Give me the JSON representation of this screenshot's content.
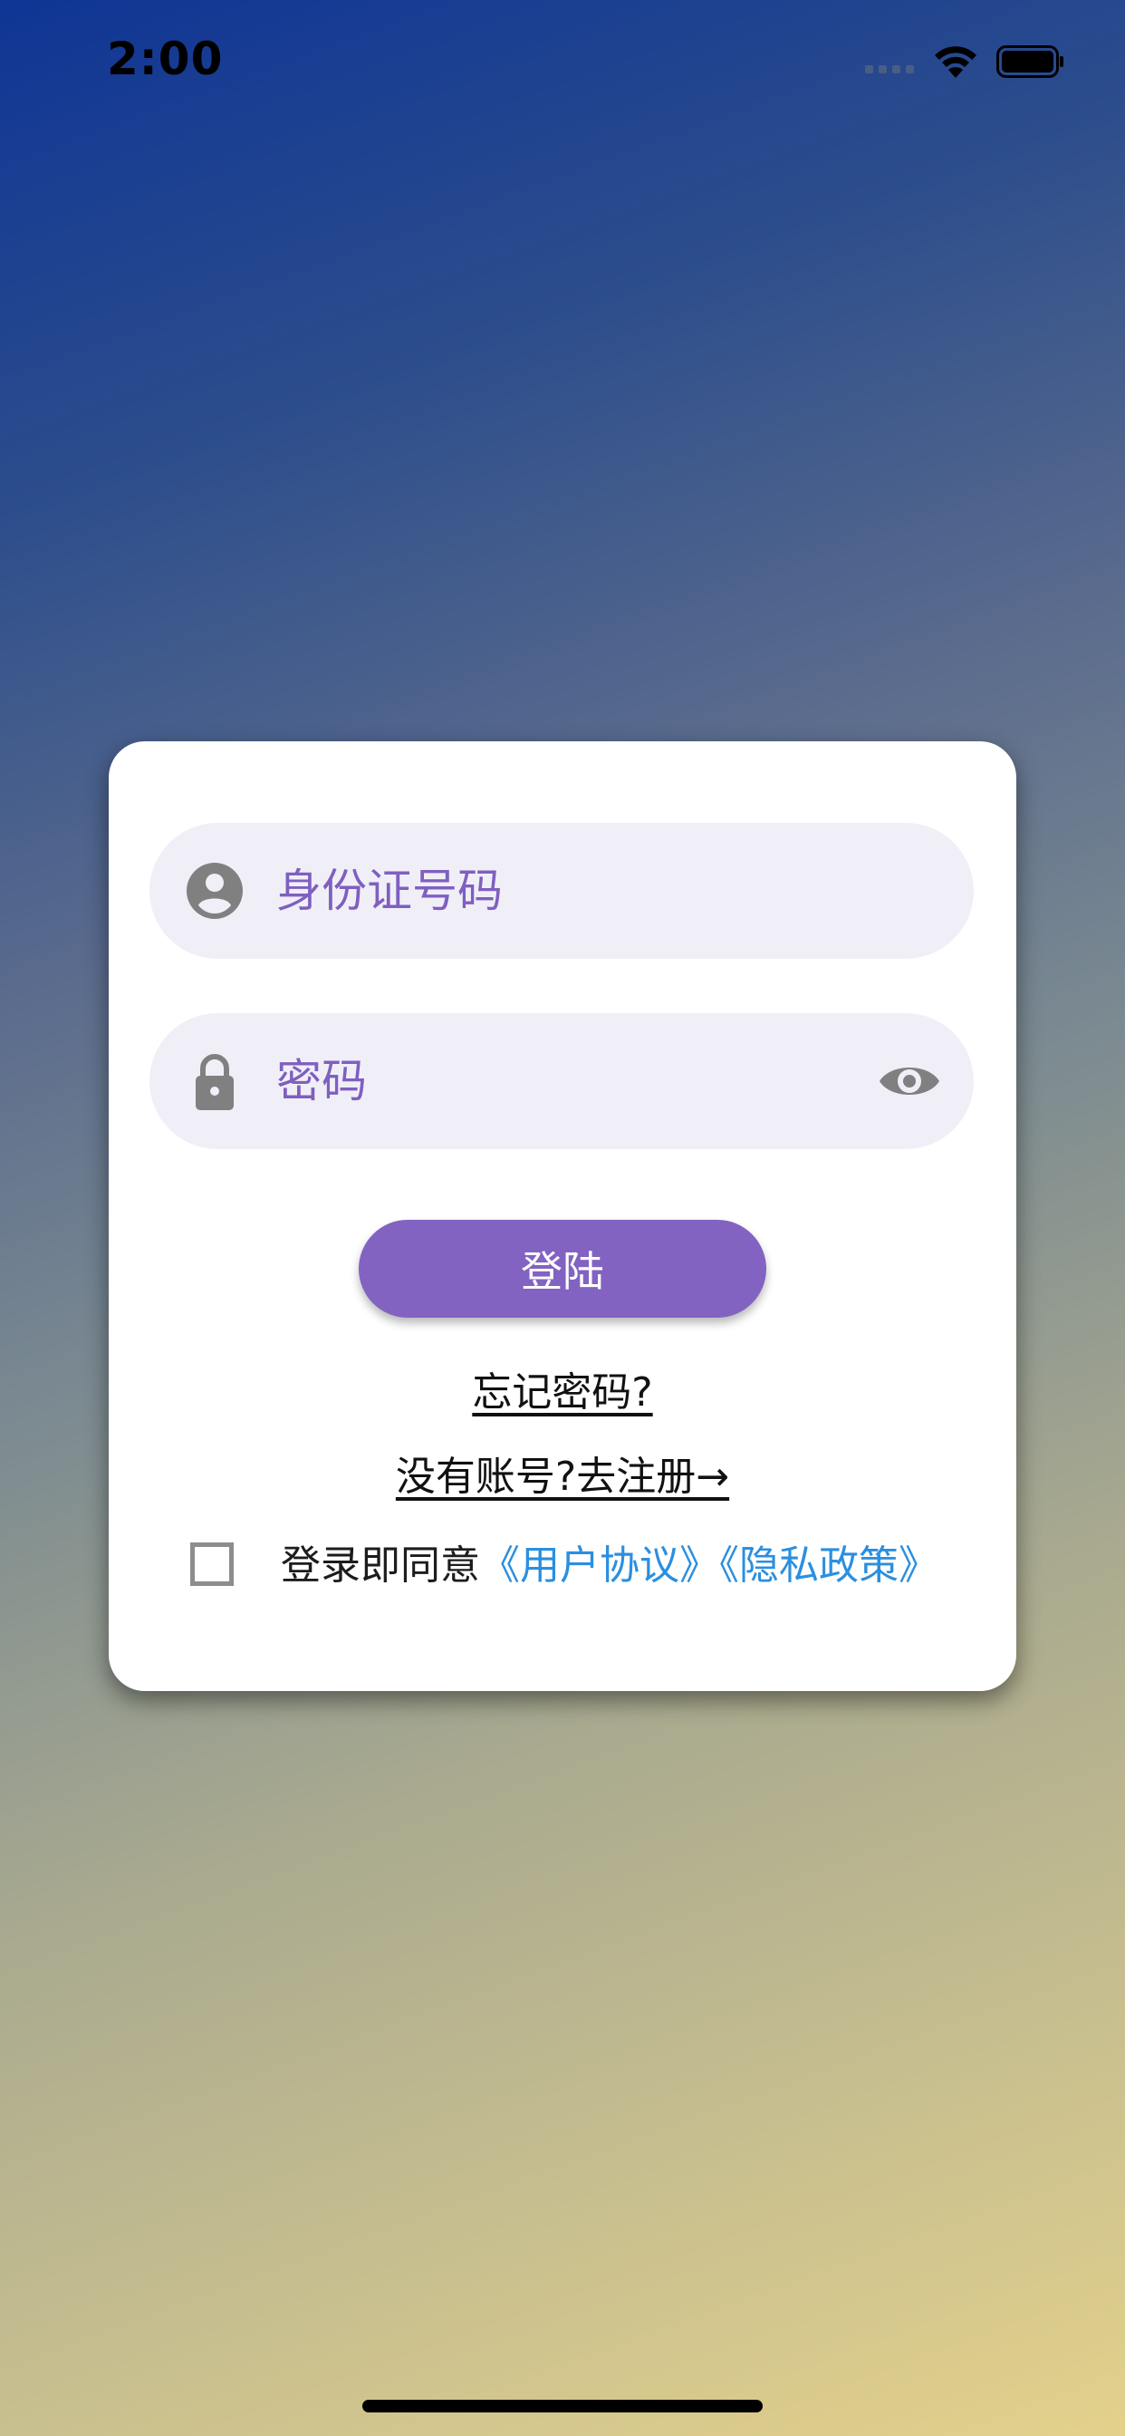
{
  "status_bar": {
    "time": "2:00"
  },
  "login_form": {
    "id_placeholder": "身份证号码",
    "password_placeholder": "密码",
    "login_label": "登陆",
    "forgot_password": "忘记密码?",
    "register": "没有账号?去注册→",
    "agree_prefix": "登录即同意",
    "user_agreement": "《用户协议》",
    "privacy_policy": "《隐私政策》"
  },
  "icons": {
    "id_field": "person-circle-icon",
    "password_field": "lock-icon",
    "toggle_password": "eye-icon"
  },
  "colors": {
    "accent": "#8263c2",
    "input_text": "#7f5fc0",
    "link": "#2b8fe0",
    "field_background": "#f0eff7"
  }
}
